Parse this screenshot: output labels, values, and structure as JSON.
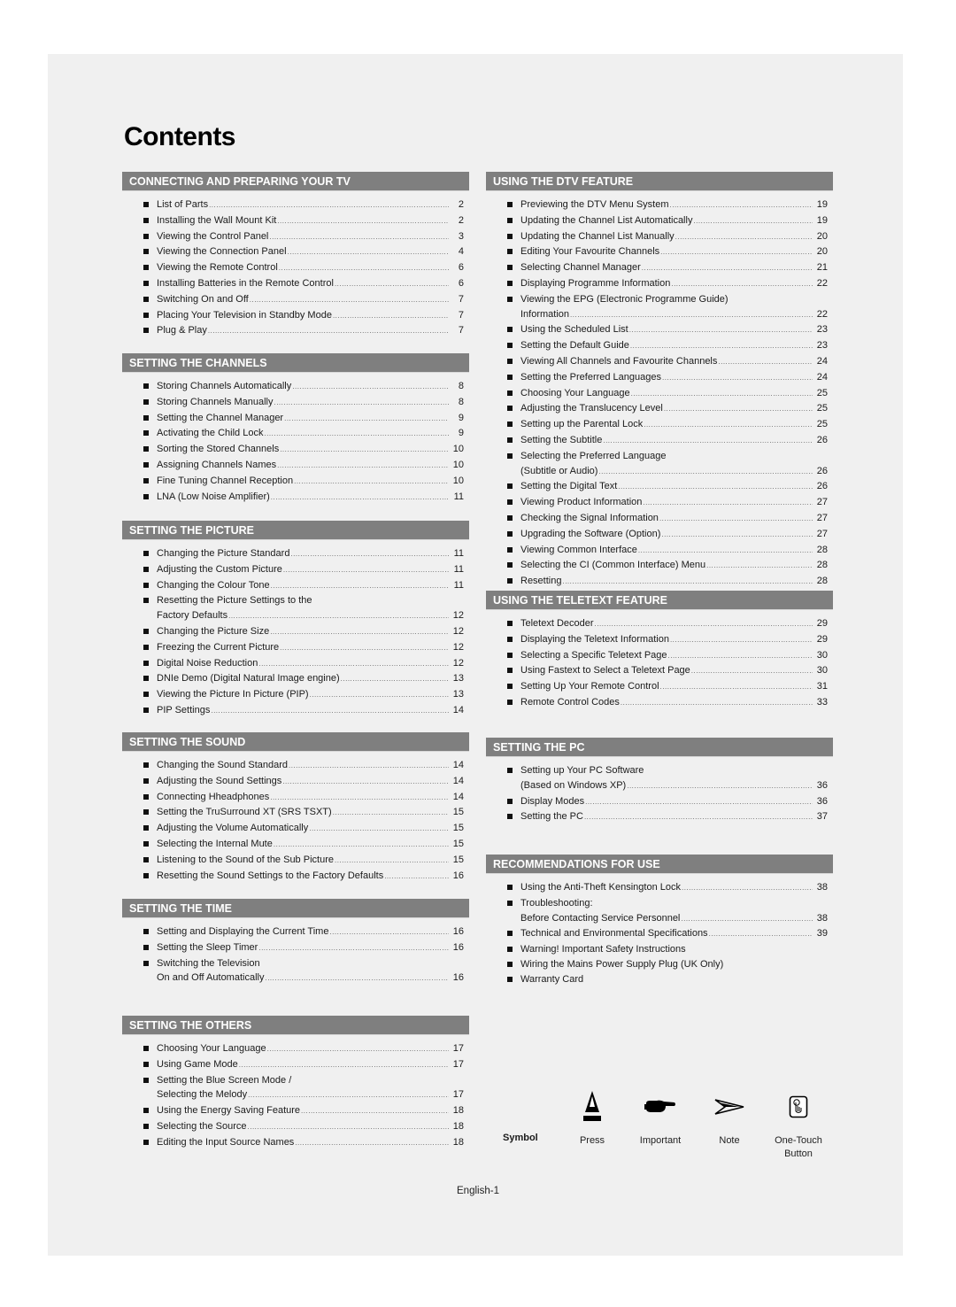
{
  "title": "Contents",
  "left_sections": [
    {
      "heading": "CONNECTING AND PREPARING YOUR TV",
      "items": [
        {
          "lines": [
            "List of Parts"
          ],
          "page": "2"
        },
        {
          "lines": [
            "Installing the Wall Mount Kit"
          ],
          "page": "2"
        },
        {
          "lines": [
            "Viewing the Control Panel"
          ],
          "page": "3"
        },
        {
          "lines": [
            "Viewing the Connection Panel"
          ],
          "page": "4"
        },
        {
          "lines": [
            "Viewing the Remote Control"
          ],
          "page": "6"
        },
        {
          "lines": [
            "Installing Batteries in the Remote Control"
          ],
          "page": "6"
        },
        {
          "lines": [
            "Switching On and Off"
          ],
          "page": "7"
        },
        {
          "lines": [
            "Placing Your Television in Standby Mode"
          ],
          "page": "7"
        },
        {
          "lines": [
            "Plug & Play"
          ],
          "page": "7"
        }
      ]
    },
    {
      "heading": "SETTING THE CHANNELS",
      "items": [
        {
          "lines": [
            "Storing Channels Automatically"
          ],
          "page": "8"
        },
        {
          "lines": [
            "Storing Channels Manually"
          ],
          "page": "8"
        },
        {
          "lines": [
            "Setting the Channel Manager"
          ],
          "page": "9"
        },
        {
          "lines": [
            "Activating the Child Lock"
          ],
          "page": "9"
        },
        {
          "lines": [
            "Sorting the Stored Channels"
          ],
          "page": "10"
        },
        {
          "lines": [
            "Assigning Channels Names"
          ],
          "page": "10"
        },
        {
          "lines": [
            "Fine Tuning Channel Reception"
          ],
          "page": "10"
        },
        {
          "lines": [
            "LNA (Low Noise Amplifier)"
          ],
          "page": "11"
        }
      ]
    },
    {
      "heading": "SETTING THE PICTURE",
      "items": [
        {
          "lines": [
            "Changing the Picture Standard"
          ],
          "page": "11"
        },
        {
          "lines": [
            "Adjusting the Custom Picture"
          ],
          "page": "11"
        },
        {
          "lines": [
            "Changing the Colour Tone"
          ],
          "page": "11"
        },
        {
          "lines": [
            "Resetting the Picture Settings to the",
            "Factory Defaults"
          ],
          "page": "12"
        },
        {
          "lines": [
            "Changing the Picture Size"
          ],
          "page": "12"
        },
        {
          "lines": [
            "Freezing the Current Picture"
          ],
          "page": "12"
        },
        {
          "lines": [
            "Digital Noise Reduction"
          ],
          "page": "12"
        },
        {
          "lines": [
            "DNIe Demo (Digital Natural Image engine)"
          ],
          "page": "13"
        },
        {
          "lines": [
            "Viewing the Picture In Picture (PIP)"
          ],
          "page": "13"
        },
        {
          "lines": [
            "PIP Settings"
          ],
          "page": "14"
        }
      ]
    },
    {
      "heading": "SETTING THE SOUND",
      "items": [
        {
          "lines": [
            "Changing the Sound Standard"
          ],
          "page": "14"
        },
        {
          "lines": [
            "Adjusting the Sound Settings"
          ],
          "page": "14"
        },
        {
          "lines": [
            "Connecting Hheadphones"
          ],
          "page": "14"
        },
        {
          "lines": [
            "Setting the TruSurround XT (SRS TSXT)"
          ],
          "page": "15"
        },
        {
          "lines": [
            "Adjusting the Volume Automatically"
          ],
          "page": "15"
        },
        {
          "lines": [
            "Selecting the Internal Mute"
          ],
          "page": "15"
        },
        {
          "lines": [
            "Listening to the Sound of the Sub Picture"
          ],
          "page": "15"
        },
        {
          "lines": [
            "Resetting the Sound Settings to the Factory Defaults"
          ],
          "page": "16"
        }
      ]
    },
    {
      "heading": "SETTING THE TIME",
      "items": [
        {
          "lines": [
            "Setting and Displaying the Current Time"
          ],
          "page": "16"
        },
        {
          "lines": [
            "Setting the Sleep Timer"
          ],
          "page": "16"
        },
        {
          "lines": [
            "Switching the Television",
            "On and Off Automatically"
          ],
          "page": "16"
        }
      ]
    },
    {
      "heading": "SETTING THE OTHERS",
      "items": [
        {
          "lines": [
            "Choosing Your Language"
          ],
          "page": "17"
        },
        {
          "lines": [
            "Using Game Mode"
          ],
          "page": "17"
        },
        {
          "lines": [
            "Setting the Blue Screen Mode /",
            "Selecting the Melody"
          ],
          "page": "17"
        },
        {
          "lines": [
            "Using the Energy Saving Feature"
          ],
          "page": "18"
        },
        {
          "lines": [
            "Selecting the Source"
          ],
          "page": "18"
        },
        {
          "lines": [
            "Editing the Input Source Names"
          ],
          "page": "18"
        }
      ]
    }
  ],
  "right_sections": [
    {
      "heading": "USING THE DTV FEATURE",
      "items": [
        {
          "lines": [
            "Previewing the DTV Menu System"
          ],
          "page": "19"
        },
        {
          "lines": [
            "Updating the Channel List Automatically"
          ],
          "page": "19"
        },
        {
          "lines": [
            "Updating the Channel List Manually"
          ],
          "page": "20"
        },
        {
          "lines": [
            "Editing Your Favourite Channels"
          ],
          "page": "20"
        },
        {
          "lines": [
            "Selecting Channel Manager"
          ],
          "page": "21"
        },
        {
          "lines": [
            "Displaying Programme Information"
          ],
          "page": "22"
        },
        {
          "lines": [
            "Viewing the EPG (Electronic Programme Guide)",
            "Information"
          ],
          "page": "22"
        },
        {
          "lines": [
            "Using the Scheduled List"
          ],
          "page": "23"
        },
        {
          "lines": [
            "Setting the Default Guide"
          ],
          "page": "23"
        },
        {
          "lines": [
            "Viewing All Channels and Favourite Channels"
          ],
          "page": "24"
        },
        {
          "lines": [
            "Setting the Preferred Languages"
          ],
          "page": "24"
        },
        {
          "lines": [
            "Choosing Your Language"
          ],
          "page": "25"
        },
        {
          "lines": [
            "Adjusting the Translucency Level"
          ],
          "page": "25"
        },
        {
          "lines": [
            "Setting up the Parental Lock"
          ],
          "page": "25"
        },
        {
          "lines": [
            "Setting the Subtitle"
          ],
          "page": "26"
        },
        {
          "lines": [
            "Selecting the Preferred Language",
            "(Subtitle or Audio)"
          ],
          "page": "26"
        },
        {
          "lines": [
            "Setting the Digital Text"
          ],
          "page": "26"
        },
        {
          "lines": [
            "Viewing Product Information"
          ],
          "page": "27"
        },
        {
          "lines": [
            "Checking the Signal Information"
          ],
          "page": "27"
        },
        {
          "lines": [
            "Upgrading the Software (Option)"
          ],
          "page": "27"
        },
        {
          "lines": [
            "Viewing Common Interface"
          ],
          "page": "28"
        },
        {
          "lines": [
            "Selecting the CI (Common Interface) Menu"
          ],
          "page": "28"
        },
        {
          "lines": [
            "Resetting"
          ],
          "page": "28"
        }
      ]
    },
    {
      "heading": "USING THE TELETEXT FEATURE",
      "items": [
        {
          "lines": [
            "Teletext Decoder"
          ],
          "page": "29"
        },
        {
          "lines": [
            "Displaying the Teletext Information"
          ],
          "page": "29"
        },
        {
          "lines": [
            "Selecting a Specific Teletext Page"
          ],
          "page": "30"
        },
        {
          "lines": [
            "Using Fastext to Select a Teletext Page"
          ],
          "page": "30"
        },
        {
          "lines": [
            "Setting Up Your Remote Control"
          ],
          "page": "31"
        },
        {
          "lines": [
            "Remote Control Codes"
          ],
          "page": "33"
        }
      ]
    },
    {
      "heading": "SETTING THE PC",
      "items": [
        {
          "lines": [
            "Setting up Your PC Software",
            "(Based on Windows XP)"
          ],
          "page": "36"
        },
        {
          "lines": [
            "Display Modes"
          ],
          "page": "36"
        },
        {
          "lines": [
            "Setting the PC"
          ],
          "page": "37"
        }
      ]
    },
    {
      "heading": "RECOMMENDATIONS FOR USE",
      "items": [
        {
          "lines": [
            "Using the Anti-Theft Kensington Lock"
          ],
          "page": "38"
        },
        {
          "lines": [
            "Troubleshooting:",
            "Before Contacting Service Personnel"
          ],
          "page": "38"
        },
        {
          "lines": [
            "Technical and Environmental Specifications"
          ],
          "page": "39"
        },
        {
          "lines": [
            "Warning! Important Safety Instructions"
          ],
          "page": ""
        },
        {
          "lines": [
            "Wiring the Mains Power Supply Plug (UK Only)"
          ],
          "page": ""
        },
        {
          "lines": [
            "Warranty Card"
          ],
          "page": ""
        }
      ]
    }
  ],
  "legend": {
    "symbol_label": "Symbol",
    "items": [
      {
        "label": "Press",
        "icon": "press-icon"
      },
      {
        "label": "Important",
        "icon": "pointing-hand-icon"
      },
      {
        "label": "Note",
        "icon": "note-arrow-icon"
      },
      {
        "label": "One-Touch\nButton",
        "icon": "one-touch-button-icon"
      }
    ]
  },
  "page_number": "English-1",
  "colors": {
    "header_bg": "#7f7f7f",
    "page_bg": "#f0f0f0",
    "text": "#1a1a1a"
  }
}
